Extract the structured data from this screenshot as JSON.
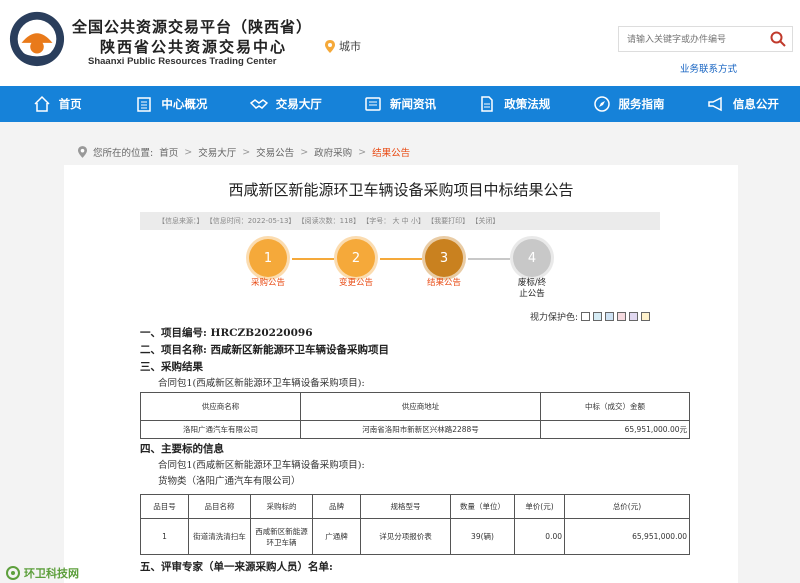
{
  "header": {
    "brand_line1": "全国公共资源交易平台（陕西省）",
    "brand_line2": "陕西省公共资源交易中心",
    "brand_en": "Shaanxi Public Resources Trading Center",
    "city": "城市",
    "search_placeholder": "请输入关键字或办件编号",
    "biz_link": "业务联系方式"
  },
  "nav": [
    {
      "label": "首页",
      "icon": "home-icon"
    },
    {
      "label": "中心概况",
      "icon": "building-icon"
    },
    {
      "label": "交易大厅",
      "icon": "handshake-icon"
    },
    {
      "label": "新闻资讯",
      "icon": "news-icon"
    },
    {
      "label": "政策法规",
      "icon": "document-icon"
    },
    {
      "label": "服务指南",
      "icon": "compass-icon"
    },
    {
      "label": "信息公开",
      "icon": "megaphone-icon"
    }
  ],
  "breadcrumb": {
    "prefix": "您所在的位置:",
    "items": [
      "首页",
      "交易大厅",
      "交易公告",
      "政府采购"
    ],
    "current": "结果公告"
  },
  "article": {
    "title": "西咸新区新能源环卫车辆设备采购项目中标结果公告",
    "meta": "【信息来源：】 【信息时间：2022-05-13】 【阅读次数：118】 【字号： 大  中  小】 【我要打印】 【关闭】",
    "steps": [
      {
        "num": "1",
        "label": "采购公告",
        "color": "#f5a93a",
        "label_color": "#e94c16"
      },
      {
        "num": "2",
        "label": "变更公告",
        "color": "#f5a93a",
        "label_color": "#e94c16"
      },
      {
        "num": "3",
        "label": "结果公告",
        "color": "#c9811f",
        "label_color": "#e94c16"
      },
      {
        "num": "4",
        "label": "废标/终止公告",
        "color": "#c8c8c8",
        "label_color": "#222"
      }
    ],
    "vision_label": "视力保护色:",
    "vision_colors": [
      "#ffffff",
      "#d6ecf5",
      "#cfe2f3",
      "#f6dbe0",
      "#e1d8f0",
      "#fff2cc"
    ],
    "sec1": "一、项目编号: HRCZB20220096",
    "sec2": "二、项目名称: 西咸新区新能源环卫车辆设备采购项目",
    "sec3": "三、采购结果",
    "contract1": "合同包1(西咸新区新能源环卫车辆设备采购项目):",
    "result_table": {
      "headers": [
        "供应商名称",
        "供应商地址",
        "中标（成交）金额"
      ],
      "row": [
        "洛阳广通汽车有限公司",
        "河南省洛阳市新新区兴林路2288号",
        "65,951,000.00元"
      ]
    },
    "sec4": "四、主要标的信息",
    "contract2": "合同包1(西咸新区新能源环卫车辆设备采购项目):",
    "goods": "货物类（洛阳广通汽车有限公司）",
    "item_table": {
      "headers": [
        "品目号",
        "品目名称",
        "采购标的",
        "品牌",
        "规格型号",
        "数量（单位）",
        "单价(元)",
        "总价(元)"
      ],
      "row": [
        "1",
        "街道清洗清扫车",
        "西咸新区新能源环卫车辆",
        "广通牌",
        "详见分项报价表",
        "39(辆)",
        "0.00",
        "65,951,000.00"
      ]
    },
    "sec5": "五、评审专家（单一来源采购人员）名单:"
  },
  "watermark": "环卫科技网"
}
